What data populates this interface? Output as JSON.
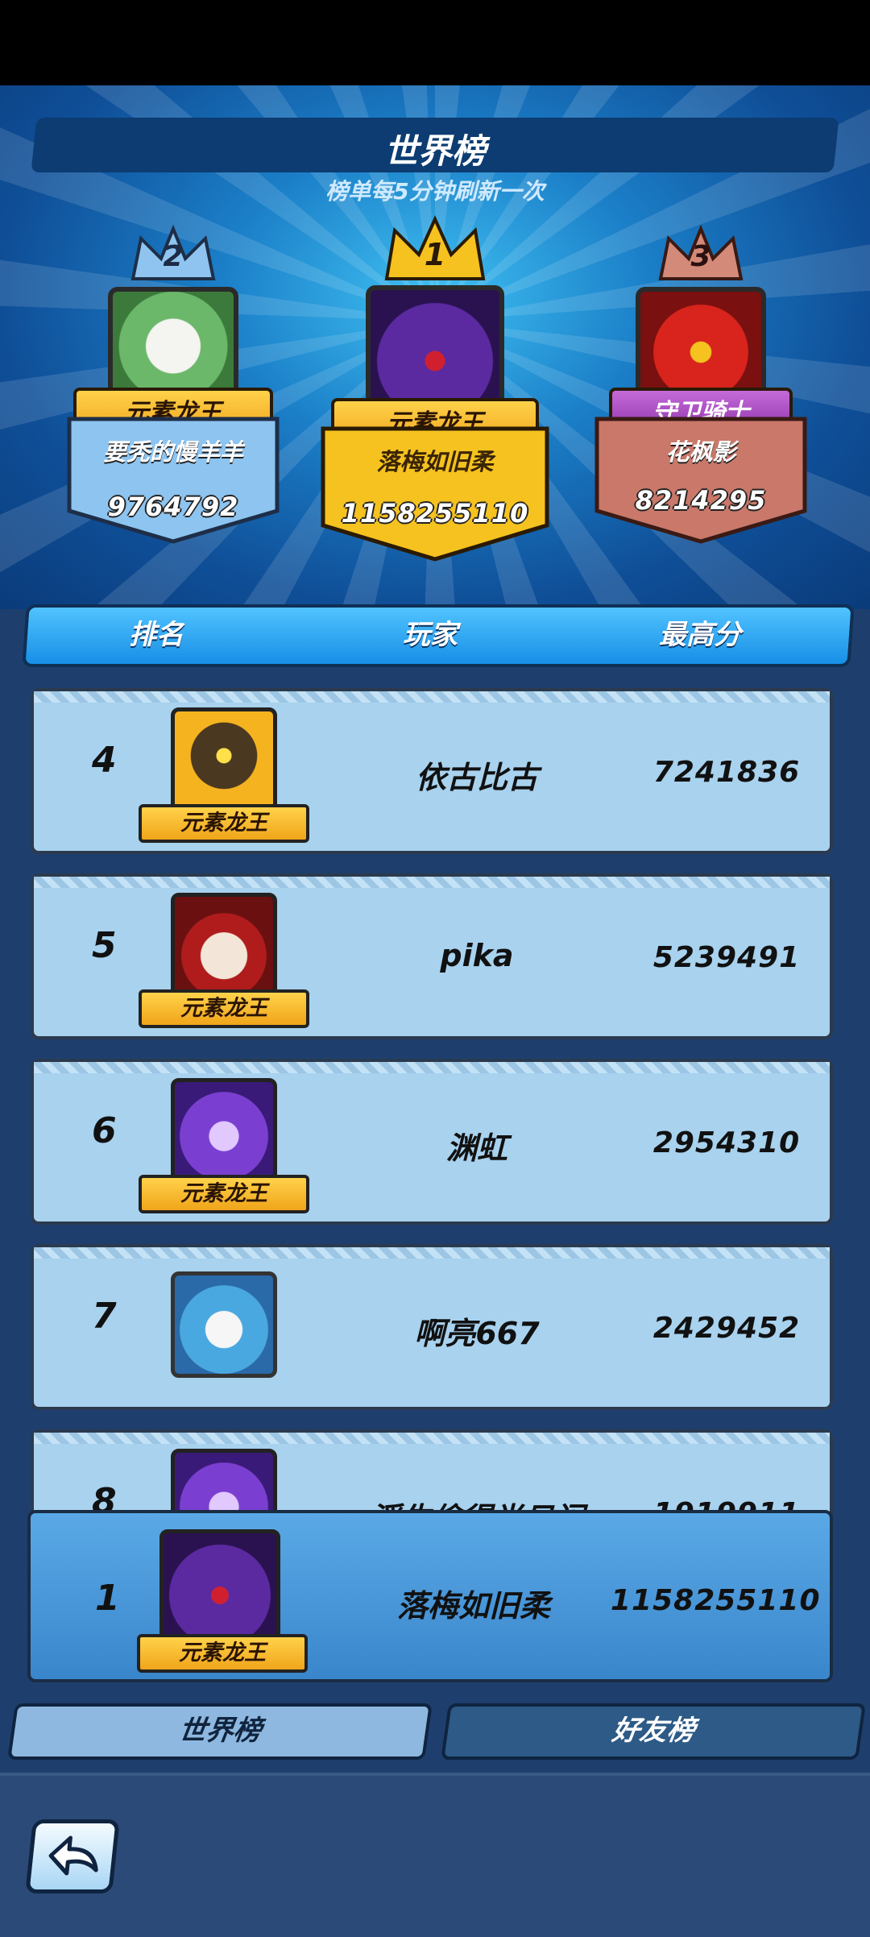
{
  "header": {
    "title": "世界榜",
    "subtitle": "榜单每5分钟刷新一次"
  },
  "podium": [
    {
      "rank": "2",
      "title": "元素龙王",
      "name": "要秃的慢羊羊",
      "score": "9764792"
    },
    {
      "rank": "1",
      "title": "元素龙王",
      "name": "落梅如旧柔",
      "score": "1158255110"
    },
    {
      "rank": "3",
      "title": "守卫骑士",
      "name": "花枫影",
      "score": "8214295"
    }
  ],
  "columns": {
    "rank": "排名",
    "player": "玩家",
    "score": "最高分"
  },
  "rows": [
    {
      "rank": "4",
      "name": "依古比古",
      "score": "7241836",
      "title": "元素龙王"
    },
    {
      "rank": "5",
      "name": "pika",
      "score": "5239491",
      "title": "元素龙王"
    },
    {
      "rank": "6",
      "name": "渊虹",
      "score": "2954310",
      "title": "元素龙王"
    },
    {
      "rank": "7",
      "name": "啊亮667",
      "score": "2429452",
      "title": ""
    },
    {
      "rank": "8",
      "name": "浮生偷得半日闲",
      "score": "1919911",
      "title": ""
    }
  ],
  "self": {
    "rank": "1",
    "name": "落梅如旧柔",
    "score": "1158255110",
    "title": "元素龙王"
  },
  "tabs": {
    "world": "世界榜",
    "friends": "好友榜"
  },
  "colors": {
    "gold": "#f5c21f",
    "silver": "#8dc4f0",
    "bronze": "#c9786a",
    "row": "#a8d2ee",
    "self_row": "#4a97d8"
  },
  "icons": {
    "back": "back-arrow-icon",
    "crown": "crown-icon"
  }
}
